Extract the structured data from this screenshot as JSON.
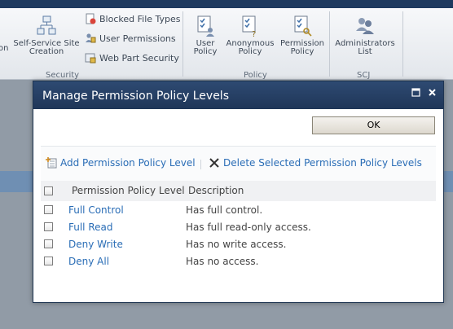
{
  "ribbon": {
    "small_items": [
      {
        "label": "Blocked File Types",
        "icon": "blocked-file-types-icon"
      },
      {
        "label": "User Permissions",
        "icon": "user-permissions-icon"
      },
      {
        "label": "Web Part Security",
        "icon": "web-part-security-icon"
      }
    ],
    "self_service": {
      "line1": "Self-Service Site",
      "line2": "Creation"
    },
    "left_cut_label": "on",
    "user_policy": {
      "line1": "User",
      "line2": "Policy"
    },
    "anonymous_policy": {
      "line1": "Anonymous",
      "line2": "Policy"
    },
    "permission_policy": {
      "line1": "Permission",
      "line2": "Policy"
    },
    "administrators_list": {
      "line1": "Administrators",
      "line2": "List"
    },
    "groups": {
      "security": "Security",
      "policy": "Policy",
      "scj": "SCJ"
    }
  },
  "dialog": {
    "title": "Manage Permission Policy Levels",
    "ok_label": "OK",
    "toolbar": {
      "add_label": "Add Permission Policy Level",
      "delete_label": "Delete Selected Permission Policy Levels"
    },
    "columns": {
      "name": "Permission Policy Level",
      "description": "Description"
    },
    "rows": [
      {
        "name": "Full Control",
        "description": "Has full control."
      },
      {
        "name": "Full Read",
        "description": "Has full read-only access."
      },
      {
        "name": "Deny Write",
        "description": "Has no write access."
      },
      {
        "name": "Deny All",
        "description": "Has no access."
      }
    ]
  },
  "colors": {
    "title_bar": "#1f3658",
    "link": "#2a6db6",
    "ribbon_top": "#1e3a5f"
  }
}
